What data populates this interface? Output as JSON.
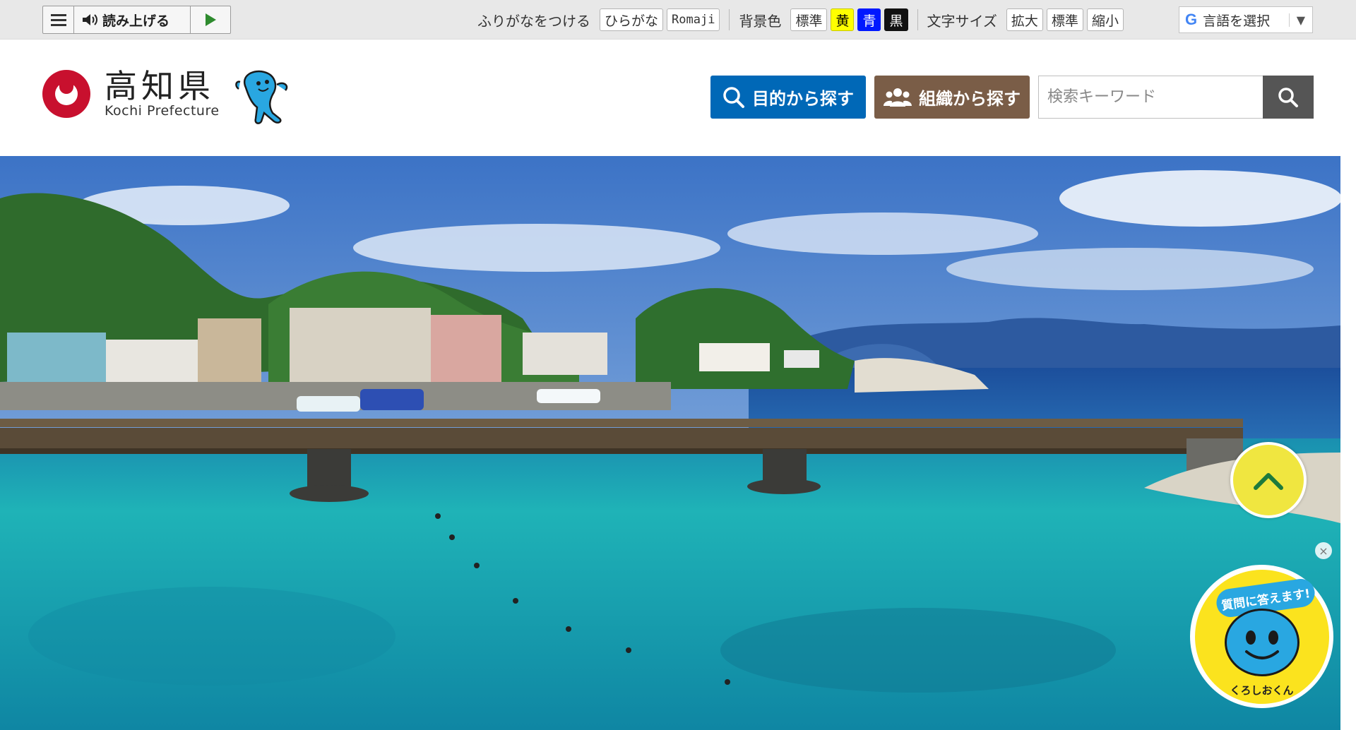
{
  "utility_bar": {
    "reader": {
      "menu_icon": "hamburger-icon",
      "speaker_icon": "speaker-icon",
      "read_label": "読み上げる",
      "play_icon": "play-icon"
    },
    "furigana": {
      "label": "ふりがなをつける",
      "hiragana": "ひらがな",
      "romaji": "Romaji"
    },
    "background": {
      "label": "背景色",
      "standard": "標準",
      "yellow": "黄",
      "blue": "青",
      "black": "黒"
    },
    "font_size": {
      "label": "文字サイズ",
      "enlarge": "拡大",
      "standard": "標準",
      "shrink": "縮小"
    },
    "language": {
      "icon": "google-g-icon",
      "label": "言語を選択",
      "arrow": "▼"
    }
  },
  "header": {
    "logo": {
      "title": "高知県",
      "subtitle": "Kochi Prefecture"
    },
    "mascot": "mascot-kuroshiokun",
    "purpose_button": "目的から探す",
    "org_button": "組織から探す",
    "search": {
      "placeholder": "検索キーワード",
      "icon": "search-icon"
    }
  },
  "hero": {
    "image": "coastal-harbor-bridge-photo",
    "back_to_top_icon": "chevron-up-icon",
    "chatbot": {
      "tag": "質問に答えます!",
      "name": "くろしおくん",
      "close": "×"
    }
  },
  "colors": {
    "purpose_button": "#0068b7",
    "org_button": "#7a5d47",
    "logo_red": "#c8102e",
    "highlight_yellow": "#ffff00",
    "highlight_blue": "#0018ff"
  }
}
